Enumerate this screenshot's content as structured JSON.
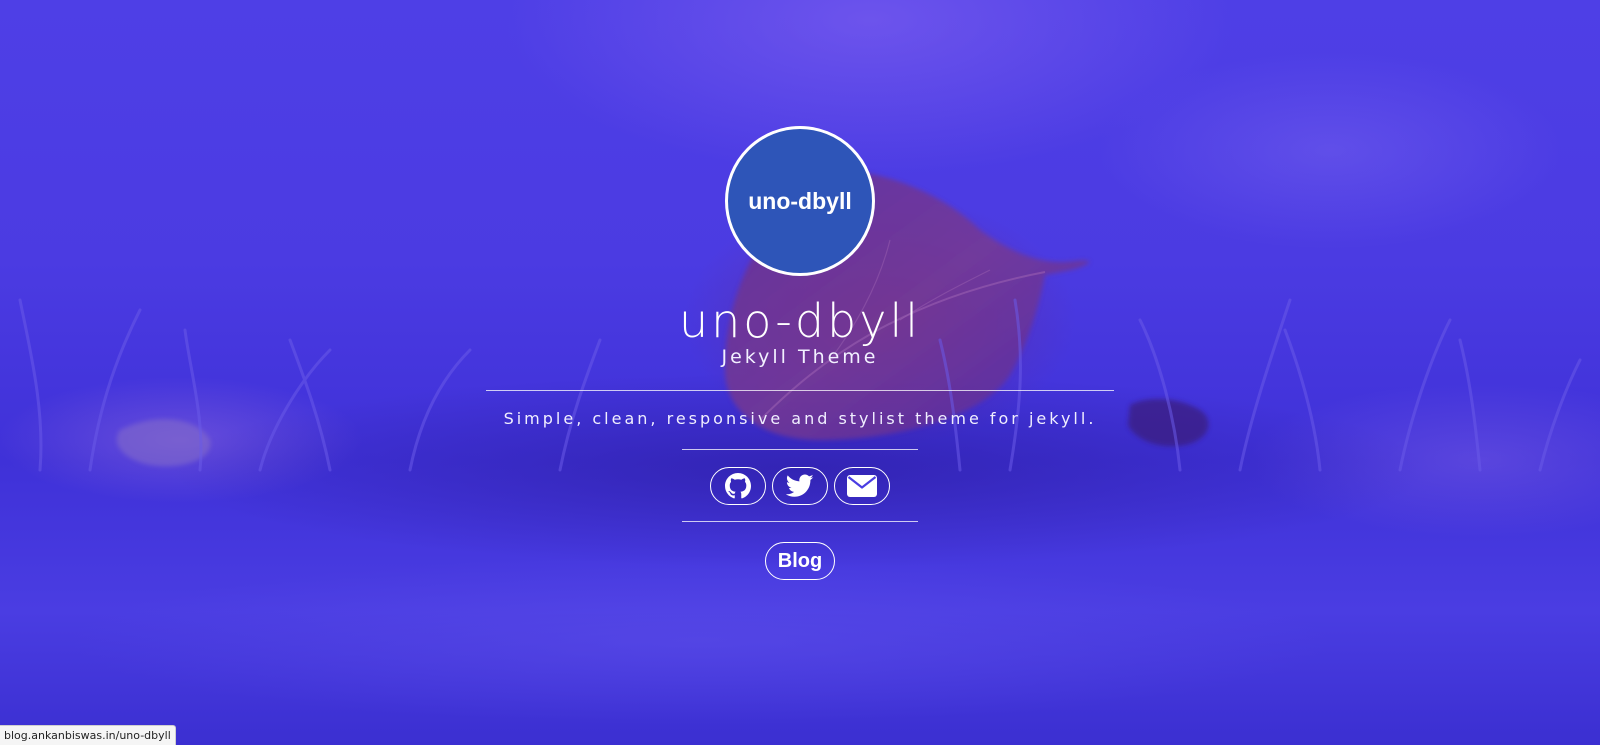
{
  "profile": {
    "avatar_text": "uno-dbyll",
    "title": "uno-dbyll",
    "subtitle": "Jekyll Theme",
    "tagline": "Simple, clean, responsive and stylist theme for jekyll."
  },
  "social": [
    {
      "icon": "github-icon"
    },
    {
      "icon": "twitter-icon"
    },
    {
      "icon": "envelope-icon"
    }
  ],
  "nav": {
    "blog_label": "Blog"
  },
  "status_bar": {
    "url": "blog.ankanbiswas.in/uno-dbyll"
  },
  "colors": {
    "background_tint": "#4535e0",
    "avatar_fill": "#2e55b8",
    "foreground": "#ffffff"
  }
}
